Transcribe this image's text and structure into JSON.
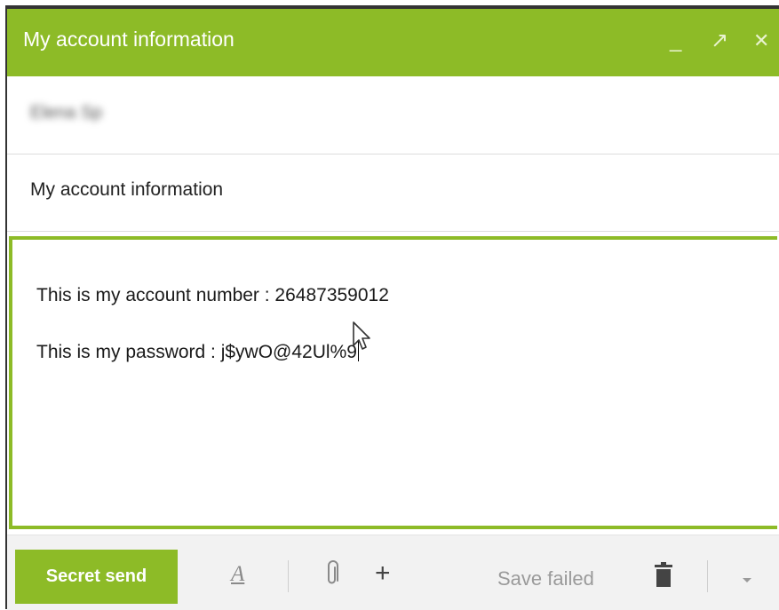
{
  "window": {
    "title": "My account information",
    "minimize_glyph": "_",
    "maximize_glyph": "↗",
    "close_glyph": "✕",
    "accent_color": "#8dbb27"
  },
  "recipient": {
    "value": "Elena Sp"
  },
  "subject": {
    "value": "My account information"
  },
  "message": {
    "line1": "This is my account number : 26487359012",
    "line2": "This is my password : j$ywO@42Ul%9"
  },
  "toolbar": {
    "send_label": "Secret send",
    "format_icon_glyph": "A",
    "attach_icon": "paperclip-icon",
    "more_glyph": "+",
    "save_status": "Save failed",
    "delete_icon": "trash-icon",
    "dropdown_icon": "chevron-down-icon"
  }
}
